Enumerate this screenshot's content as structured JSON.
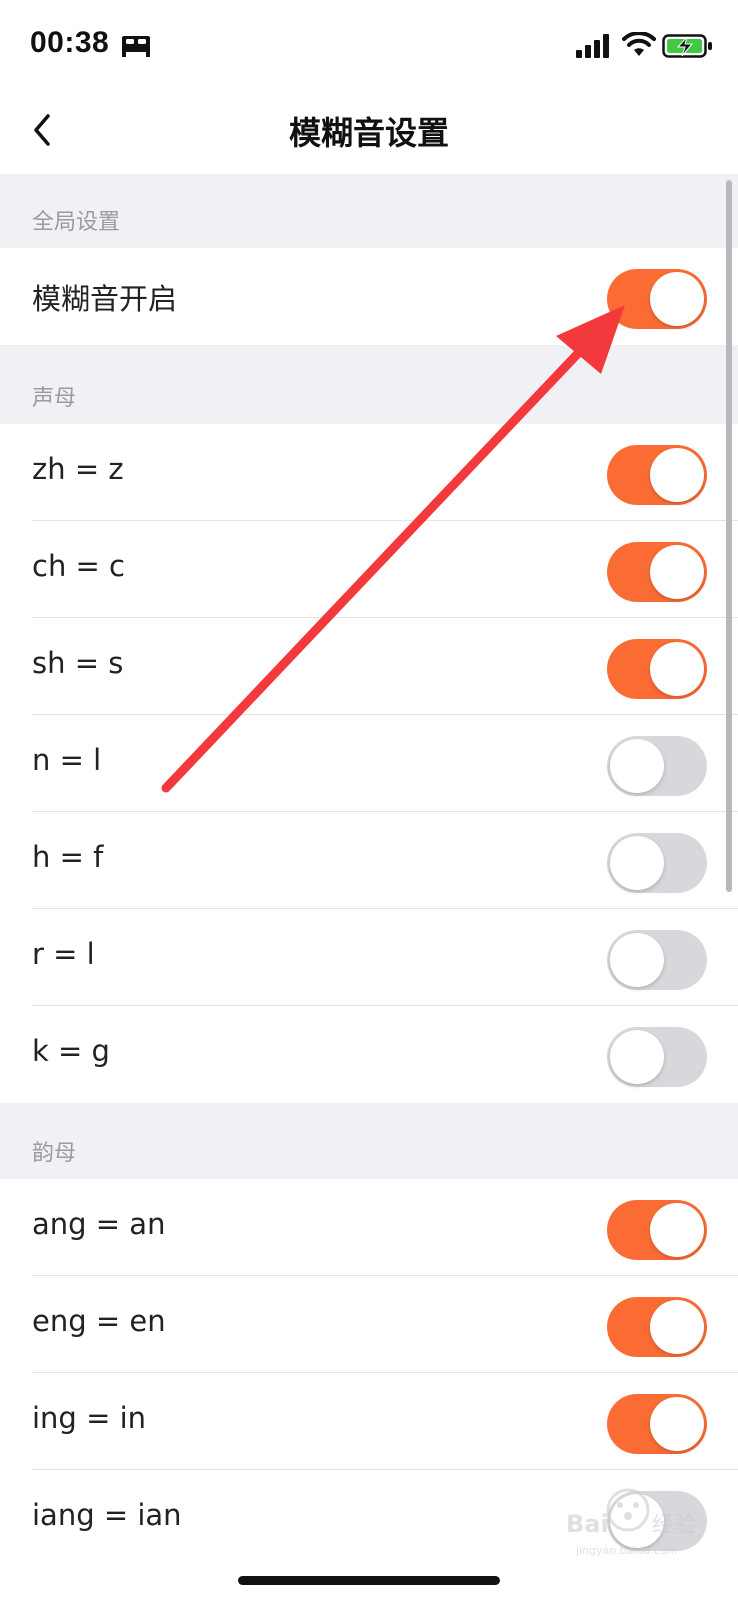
{
  "status_bar": {
    "time": "00:38",
    "icons": [
      "bed-icon",
      "signal-icon",
      "wifi-icon",
      "battery-charging-icon"
    ]
  },
  "nav": {
    "title": "模糊音设置",
    "back_icon": "chevron-left-icon"
  },
  "sections": [
    {
      "header": "全局设置",
      "rows": [
        {
          "label": "模糊音开启",
          "on": true
        }
      ]
    },
    {
      "header": "声母",
      "rows": [
        {
          "label": "zh = z",
          "on": true
        },
        {
          "label": "ch = c",
          "on": true
        },
        {
          "label": "sh = s",
          "on": true
        },
        {
          "label": "n = l",
          "on": false
        },
        {
          "label": "h = f",
          "on": false
        },
        {
          "label": "r = l",
          "on": false
        },
        {
          "label": "k = g",
          "on": false
        }
      ]
    },
    {
      "header": "韵母",
      "rows": [
        {
          "label": "ang = an",
          "on": true
        },
        {
          "label": "eng = en",
          "on": true
        },
        {
          "label": "ing = in",
          "on": true
        },
        {
          "label": "iang = ian",
          "on": false
        }
      ]
    }
  ],
  "colors": {
    "toggle_on": "#fb6c35",
    "toggle_off": "#d8d8dc",
    "annotation_arrow": "#f4393c"
  },
  "watermark": {
    "text": "Baidu经验",
    "url_text": "jingyan.baidu.com"
  }
}
